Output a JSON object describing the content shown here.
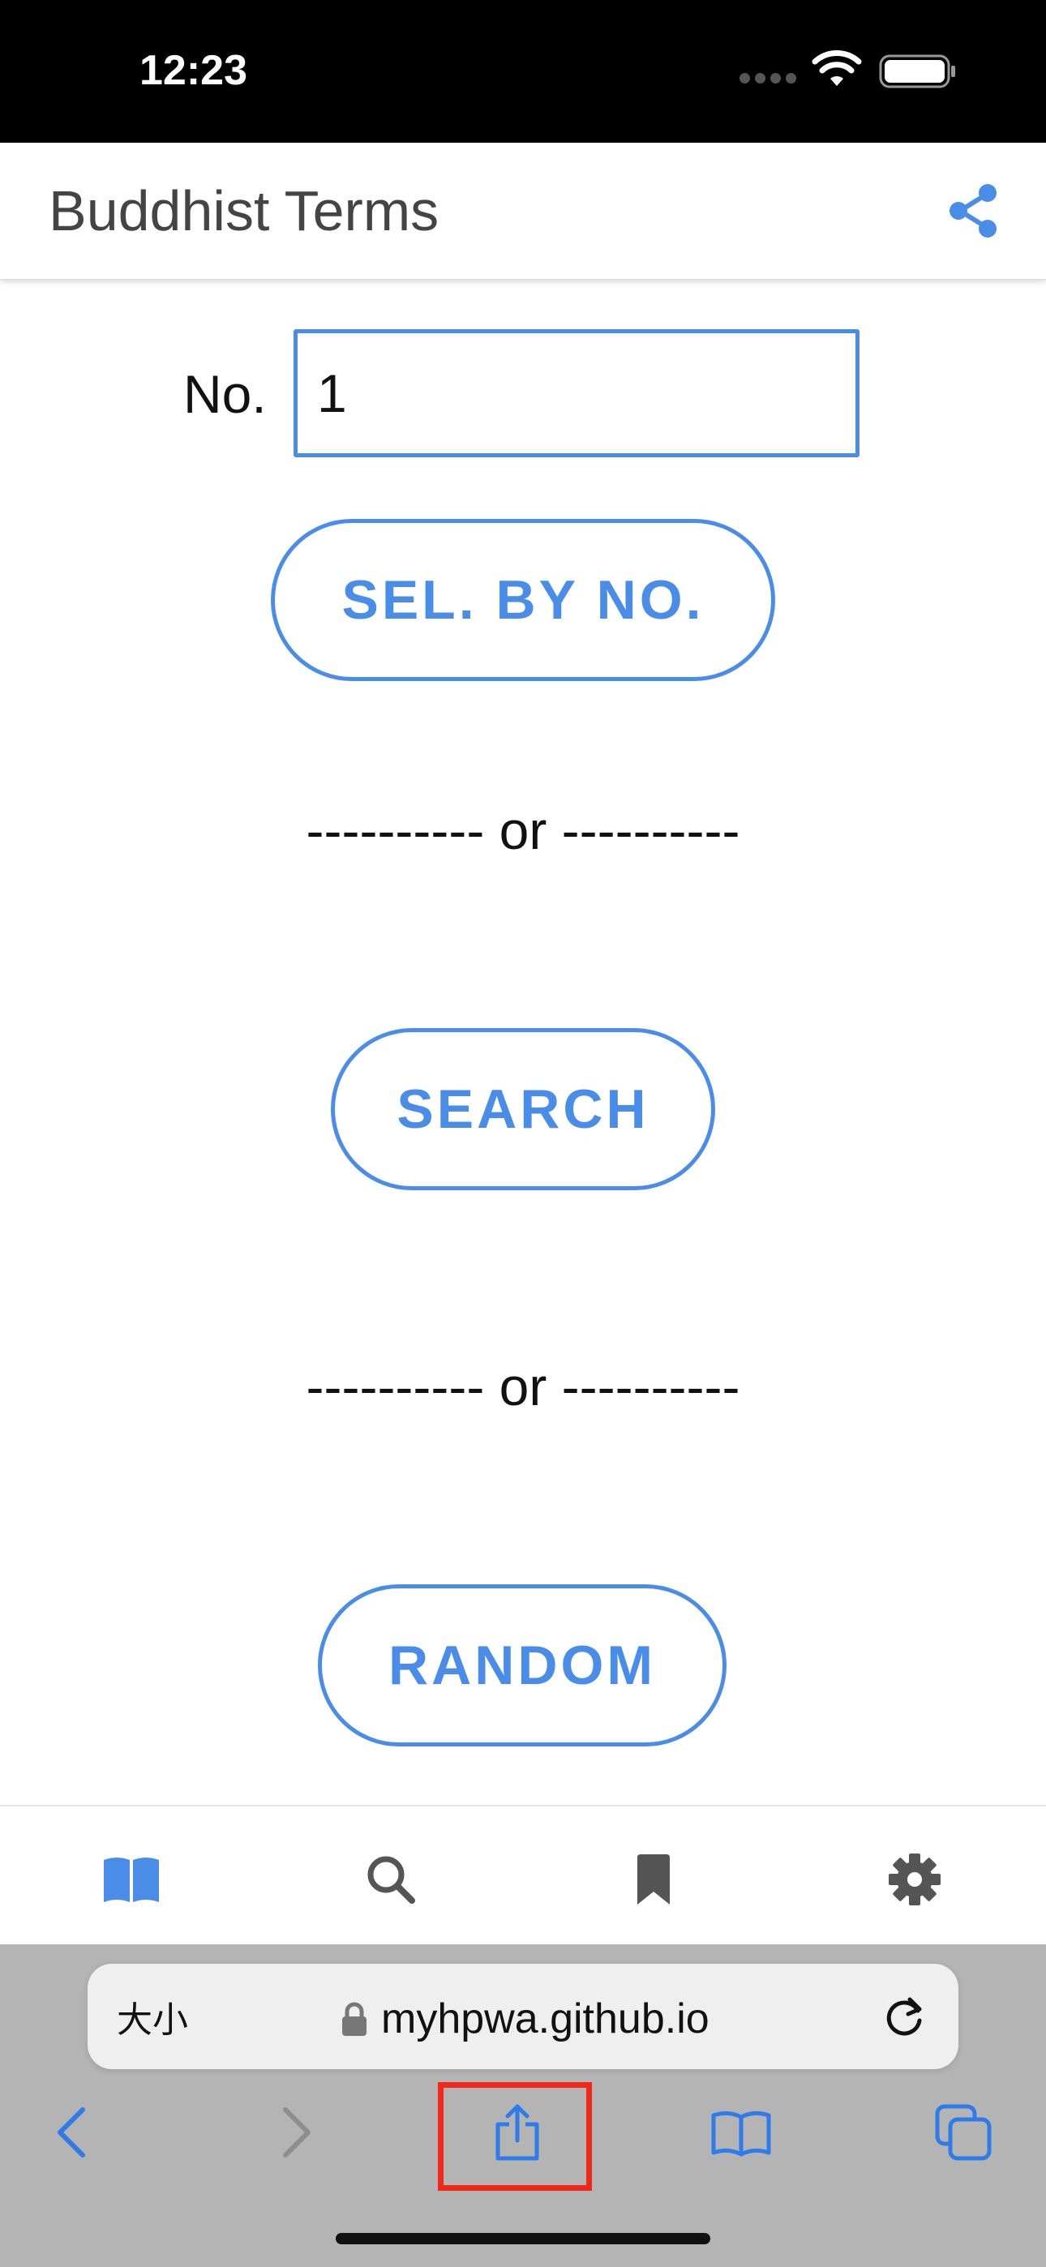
{
  "status_bar": {
    "time": "12:23",
    "icons": [
      "signal-icon",
      "wifi-icon",
      "battery-icon"
    ]
  },
  "header": {
    "title": "Buddhist Terms",
    "share_icon": "share-icon"
  },
  "main": {
    "number_label": "No.",
    "number_value": "1",
    "select_button": "SEL. BY NO.",
    "divider_1": "---------- or ----------",
    "search_button": "SEARCH",
    "divider_2": "---------- or ----------",
    "random_button": "RANDOM"
  },
  "bottom_nav": {
    "items": [
      {
        "name": "book",
        "icon": "book-open-icon",
        "active": true
      },
      {
        "name": "search",
        "icon": "search-icon",
        "active": false
      },
      {
        "name": "bookmark",
        "icon": "bookmark-icon",
        "active": false
      },
      {
        "name": "settings",
        "icon": "gear-icon",
        "active": false
      }
    ]
  },
  "browser": {
    "text_size_label": "大小",
    "url": "myhpwa.github.io",
    "toolbar": [
      "back-icon",
      "forward-icon",
      "share-icon",
      "bookmarks-icon",
      "tabs-icon"
    ]
  },
  "colors": {
    "accent": "#4a8de8",
    "nav_active": "#4a8de8",
    "nav_inactive": "#555555",
    "highlight": "#f0281a",
    "safari_bar": "#b4b4b4",
    "status_bar": "#000000"
  }
}
